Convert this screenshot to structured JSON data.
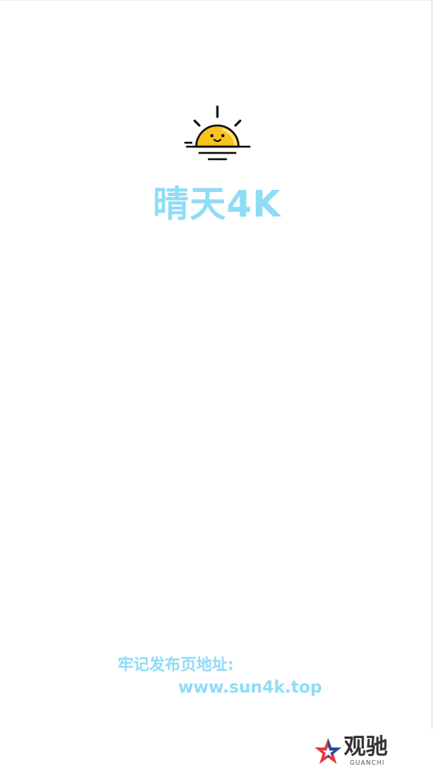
{
  "app": {
    "title": "晴天4K",
    "logo_icon": "sun-face-icon",
    "accent_color": "#8fdcf6",
    "sun_color": "#f7c31d"
  },
  "footer": {
    "notice": "牢记发布页地址:",
    "url": "www.sun4k.top"
  },
  "watermark": {
    "name_cn": "观驰",
    "name_en": "GUANCHI",
    "icon": "star-icon"
  }
}
